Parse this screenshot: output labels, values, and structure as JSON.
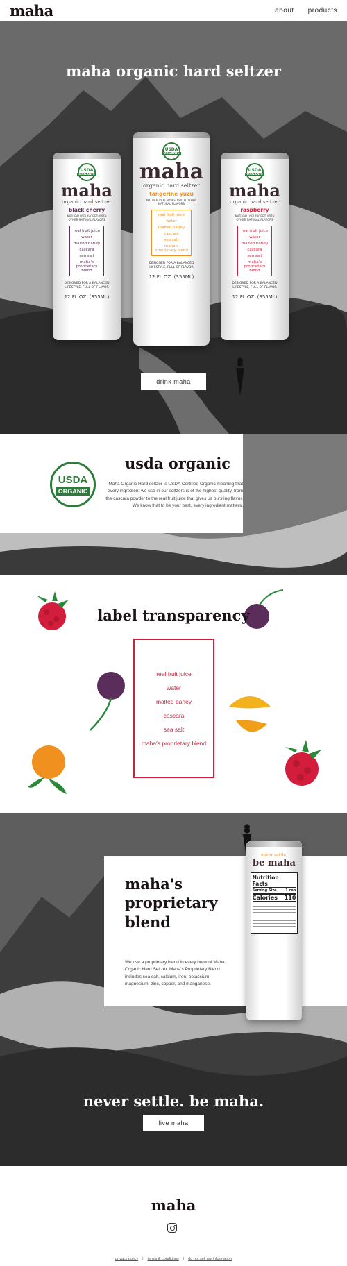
{
  "nav": {
    "logo": "maha",
    "links": [
      "about",
      "products"
    ]
  },
  "hero": {
    "title": "maha organic hard seltzer",
    "cta": "drink maha"
  },
  "cans": [
    {
      "brand": "maha",
      "sub": "organic hard seltzer",
      "flavor": "black cherry",
      "color": "#5b2d5a"
    },
    {
      "brand": "maha",
      "sub": "organic hard seltzer",
      "flavor": "tangerine yuzu",
      "color": "#f0901e"
    },
    {
      "brand": "maha",
      "sub": "organic hard seltzer",
      "flavor": "raspberry",
      "color": "#d7233f"
    }
  ],
  "can_text": {
    "usda": "USDA",
    "organic": "ORGANIC",
    "natural": "NATURALLY FLAVORED WITH OTHER NATURAL FLAVORS",
    "designed": "DESIGNED FOR A BALANCED LIFESTYLE, FULL OF FLAVOR",
    "volume": "12 FL.OZ. (355ML)"
  },
  "ingredients": [
    "real fruit juice",
    "water",
    "malted barley",
    "cascara",
    "sea salt",
    "maha's proprietary blend"
  ],
  "usda_section": {
    "title": "usda organic",
    "seal_top": "USDA",
    "seal_bottom": "ORGANIC",
    "body": "Maha Organic Hard seltzer is USDA Certified Organic meaning that every ingredient we use in our seltzers is of the highest quality, from the cascara powder to the real fruit juice that gives us bursting flavor. We know that to be your best, every ingredient matters."
  },
  "transparency": {
    "title": "label transparency"
  },
  "blend": {
    "title_lines": [
      "maha's",
      "proprietary",
      "blend"
    ],
    "body": "We use a proprietary blend in every brew of Maha Organic Hard Seltzer. Maha's Proprietary Blend includes sea salt, calcium, iron, potassium, magnesium, zinc, copper, and manganese.",
    "can_top": "never settle.",
    "can_brand": "be maha",
    "facts_title": "Nutrition Facts",
    "serving": "Serving Size",
    "serving_val": "1 can",
    "calories": "Calories",
    "calories_val": "110"
  },
  "closing": {
    "tagline": "never settle. be maha.",
    "cta": "live maha"
  },
  "footer": {
    "logo": "maha",
    "links": [
      "privacy policy",
      "terms & conditions",
      "do not sell my information"
    ]
  },
  "colors": {
    "ink": "#1a1216",
    "usda_green": "#2d7a3a",
    "accent_red": "#d21e3c"
  }
}
